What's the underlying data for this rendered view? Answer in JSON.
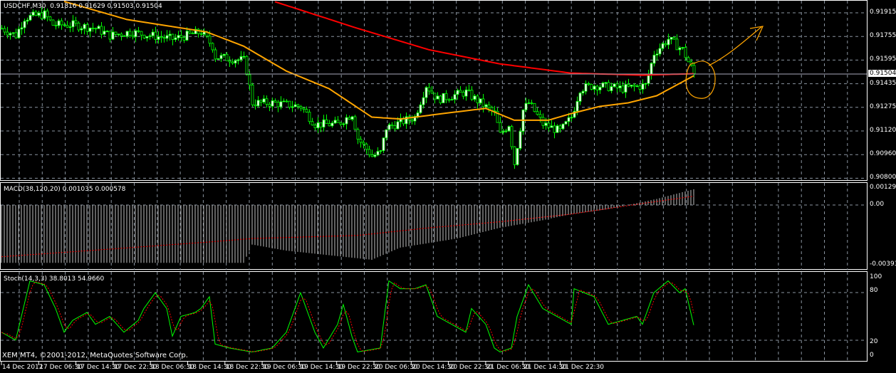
{
  "main": {
    "symbol_label": "USDCHF,M30",
    "ohlc_label": "0.91816 0.91629 0.91503 0.91504",
    "current_price": "0.91504",
    "price_axis": [
      "0.91915",
      "0.91755",
      "0.91595",
      "0.91435",
      "0.91275",
      "0.91120",
      "0.90960",
      "0.90800"
    ],
    "colors": {
      "bull": "#00ff00",
      "bear": "#00ff00",
      "slow_ma": "#ff0000",
      "fast_ma": "#ffa500",
      "annotation": "#ffa500",
      "grid": "#8a94a0"
    }
  },
  "macd": {
    "label": "MACD(38,120,20) 0.001035 0.000578",
    "axis": [
      "0.001296",
      "0.00",
      "-0.00393"
    ]
  },
  "stoch": {
    "label": "Stoch(14,3,3) 38.8013 54.9660",
    "axis": [
      "100",
      "80",
      "20",
      "0"
    ]
  },
  "footer": {
    "copyright": "XEM MT4, ©2001-2012, MetaQuotes Software Corp."
  },
  "time_axis": [
    "14 Dec 2012",
    "17 Dec 06:30",
    "17 Dec 14:30",
    "17 Dec 22:30",
    "18 Dec 06:30",
    "18 Dec 14:30",
    "18 Dec 22:30",
    "19 Dec 06:30",
    "19 Dec 14:30",
    "19 Dec 22:30",
    "20 Dec 06:30",
    "20 Dec 14:30",
    "20 Dec 22:30",
    "21 Dec 06:30",
    "21 Dec 14:30",
    "21 Dec 22:30"
  ],
  "chart_data": {
    "type": "candlestick",
    "price_range": [
      0.908,
      0.91915
    ],
    "close_keypoints_by_bar": [
      [
        0,
        0.9181
      ],
      [
        5,
        0.91762
      ],
      [
        8,
        0.91881
      ],
      [
        15,
        0.91905
      ],
      [
        18,
        0.91834
      ],
      [
        25,
        0.91834
      ],
      [
        33,
        0.9181
      ],
      [
        38,
        0.91762
      ],
      [
        45,
        0.91786
      ],
      [
        60,
        0.91738
      ],
      [
        70,
        0.91786
      ],
      [
        74,
        0.9169
      ],
      [
        75,
        0.91618
      ],
      [
        85,
        0.91594
      ],
      [
        86,
        0.91522
      ],
      [
        88,
        0.91307
      ],
      [
        95,
        0.91307
      ],
      [
        105,
        0.91283
      ],
      [
        110,
        0.91163
      ],
      [
        118,
        0.91163
      ],
      [
        123,
        0.91235
      ],
      [
        125,
        0.91067
      ],
      [
        130,
        0.90947
      ],
      [
        133,
        0.90971
      ],
      [
        135,
        0.91139
      ],
      [
        145,
        0.91211
      ],
      [
        149,
        0.91426
      ],
      [
        153,
        0.91331
      ],
      [
        163,
        0.91379
      ],
      [
        168,
        0.91307
      ],
      [
        173,
        0.91235
      ],
      [
        175,
        0.91091
      ],
      [
        178,
        0.91163
      ],
      [
        180,
        0.90899
      ],
      [
        183,
        0.91259
      ],
      [
        185,
        0.91307
      ],
      [
        190,
        0.91163
      ],
      [
        196,
        0.91115
      ],
      [
        200,
        0.91211
      ],
      [
        203,
        0.91403
      ],
      [
        208,
        0.91426
      ],
      [
        218,
        0.91403
      ],
      [
        226,
        0.91426
      ],
      [
        229,
        0.91642
      ],
      [
        234,
        0.91738
      ],
      [
        239,
        0.91666
      ],
      [
        243,
        0.91504
      ]
    ],
    "slow_ma": [
      [
        96,
        0.9199
      ],
      [
        125,
        0.9181
      ],
      [
        150,
        0.91666
      ],
      [
        175,
        0.9157
      ],
      [
        200,
        0.91508
      ],
      [
        225,
        0.91494
      ],
      [
        243,
        0.91504
      ]
    ],
    "fast_ma": [
      [
        22,
        0.91992
      ],
      [
        44,
        0.9187
      ],
      [
        72,
        0.91786
      ],
      [
        85,
        0.9169
      ],
      [
        100,
        0.91522
      ],
      [
        115,
        0.91403
      ],
      [
        130,
        0.91211
      ],
      [
        140,
        0.91198
      ],
      [
        155,
        0.91235
      ],
      [
        170,
        0.9127
      ],
      [
        180,
        0.9119
      ],
      [
        192,
        0.9119
      ],
      [
        200,
        0.91235
      ],
      [
        210,
        0.91283
      ],
      [
        220,
        0.91307
      ],
      [
        230,
        0.91355
      ],
      [
        243,
        0.9149
      ]
    ],
    "macd_range": [
      -0.00393,
      0.001296
    ],
    "macd_histogram": [
      [
        0,
        -0.0038
      ],
      [
        85,
        -0.0038
      ],
      [
        88,
        -0.0026
      ],
      [
        100,
        -0.003
      ],
      [
        125,
        -0.0035
      ],
      [
        130,
        -0.0036
      ],
      [
        140,
        -0.0028
      ],
      [
        160,
        -0.0022
      ],
      [
        175,
        -0.0015
      ],
      [
        190,
        -0.001
      ],
      [
        200,
        -0.0006
      ],
      [
        212,
        -0.0003
      ],
      [
        220,
        0.0
      ],
      [
        230,
        0.0004
      ],
      [
        243,
        0.001035
      ]
    ],
    "macd_signal": [
      [
        0,
        -0.0034
      ],
      [
        38,
        -0.0029
      ],
      [
        75,
        -0.0024
      ],
      [
        88,
        -0.0022
      ],
      [
        125,
        -0.002
      ],
      [
        150,
        -0.0015
      ],
      [
        175,
        -0.0011
      ],
      [
        200,
        -0.0006
      ],
      [
        225,
        0.0001
      ],
      [
        243,
        0.000578
      ]
    ],
    "stoch_range": [
      0,
      100
    ],
    "stoch_main": [
      [
        0,
        30
      ],
      [
        5,
        20
      ],
      [
        10,
        95
      ],
      [
        15,
        90
      ],
      [
        19,
        60
      ],
      [
        22,
        30
      ],
      [
        25,
        45
      ],
      [
        30,
        55
      ],
      [
        33,
        40
      ],
      [
        38,
        50
      ],
      [
        43,
        30
      ],
      [
        48,
        45
      ],
      [
        50,
        60
      ],
      [
        54,
        80
      ],
      [
        58,
        60
      ],
      [
        60,
        25
      ],
      [
        63,
        50
      ],
      [
        68,
        55
      ],
      [
        70,
        60
      ],
      [
        73,
        75
      ],
      [
        75,
        15
      ],
      [
        80,
        10
      ],
      [
        88,
        5
      ],
      [
        95,
        10
      ],
      [
        100,
        30
      ],
      [
        105,
        80
      ],
      [
        110,
        30
      ],
      [
        113,
        10
      ],
      [
        118,
        40
      ],
      [
        120,
        65
      ],
      [
        123,
        25
      ],
      [
        125,
        5
      ],
      [
        133,
        10
      ],
      [
        136,
        95
      ],
      [
        140,
        85
      ],
      [
        145,
        85
      ],
      [
        149,
        90
      ],
      [
        153,
        50
      ],
      [
        158,
        40
      ],
      [
        163,
        30
      ],
      [
        165,
        60
      ],
      [
        170,
        40
      ],
      [
        173,
        10
      ],
      [
        175,
        5
      ],
      [
        179,
        10
      ],
      [
        181,
        50
      ],
      [
        185,
        90
      ],
      [
        190,
        60
      ],
      [
        195,
        50
      ],
      [
        200,
        40
      ],
      [
        201,
        85
      ],
      [
        208,
        75
      ],
      [
        213,
        40
      ],
      [
        218,
        45
      ],
      [
        223,
        50
      ],
      [
        225,
        40
      ],
      [
        229,
        80
      ],
      [
        234,
        95
      ],
      [
        238,
        80
      ],
      [
        240,
        85
      ],
      [
        243,
        39
      ]
    ]
  }
}
